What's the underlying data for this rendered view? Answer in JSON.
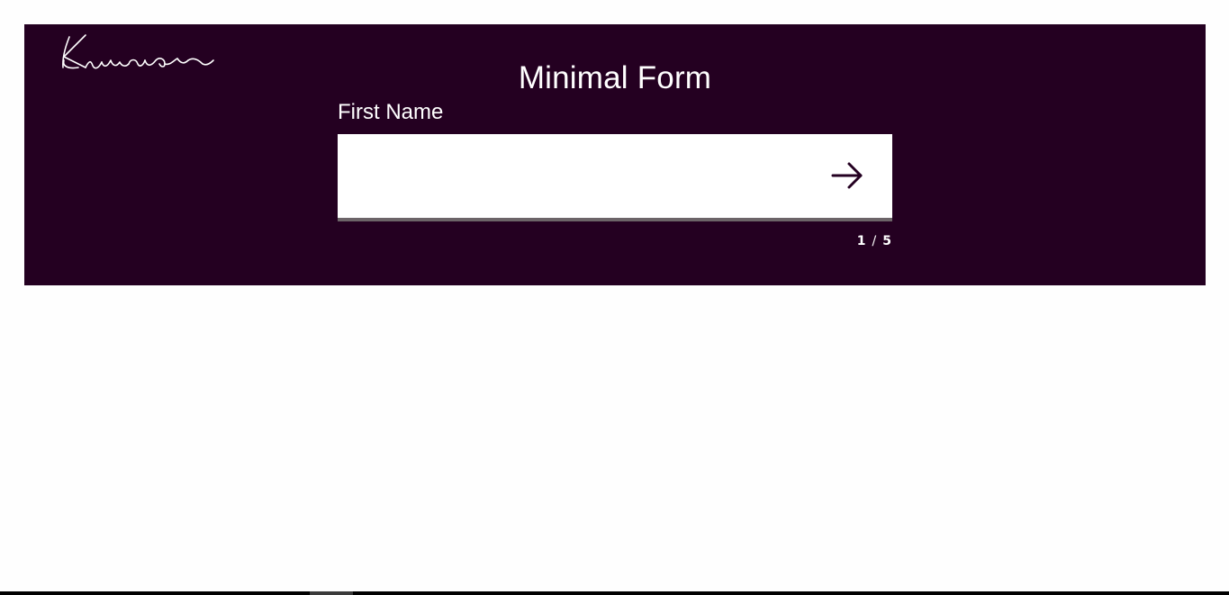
{
  "logo": {
    "text": "Kumar",
    "icon": "signature-logo"
  },
  "form": {
    "title": "Minimal Form",
    "field_label": "First Name",
    "field_value": "",
    "field_placeholder": "",
    "next_icon": "arrow-right-icon"
  },
  "progress": {
    "current": "1",
    "separator": "/",
    "total": "5"
  },
  "colors": {
    "background": "#240021",
    "accent": "#ffffff",
    "input_underline": "#6c6468"
  }
}
